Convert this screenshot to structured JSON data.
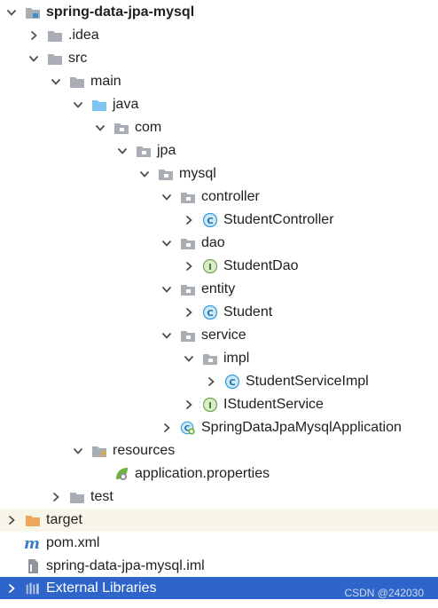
{
  "tree": [
    {
      "label": "spring-data-jpa-mysql",
      "icon": "project-folder-icon",
      "state": "expanded",
      "bold": true
    },
    {
      "label": ".idea",
      "icon": "folder-icon",
      "state": "collapsed"
    },
    {
      "label": "src",
      "icon": "folder-icon",
      "state": "expanded"
    },
    {
      "label": "main",
      "icon": "folder-icon",
      "state": "expanded"
    },
    {
      "label": "java",
      "icon": "source-folder-icon",
      "state": "expanded"
    },
    {
      "label": "com",
      "icon": "package-icon",
      "state": "expanded"
    },
    {
      "label": "jpa",
      "icon": "package-icon",
      "state": "expanded"
    },
    {
      "label": "mysql",
      "icon": "package-icon",
      "state": "expanded"
    },
    {
      "label": "controller",
      "icon": "package-icon",
      "state": "expanded"
    },
    {
      "label": "StudentController",
      "icon": "class-icon",
      "state": "collapsed"
    },
    {
      "label": "dao",
      "icon": "package-icon",
      "state": "expanded"
    },
    {
      "label": "StudentDao",
      "icon": "interface-icon",
      "state": "collapsed"
    },
    {
      "label": "entity",
      "icon": "package-icon",
      "state": "expanded"
    },
    {
      "label": "Student",
      "icon": "class-icon",
      "state": "collapsed"
    },
    {
      "label": "service",
      "icon": "package-icon",
      "state": "expanded"
    },
    {
      "label": "impl",
      "icon": "package-icon",
      "state": "expanded"
    },
    {
      "label": "StudentServiceImpl",
      "icon": "class-icon",
      "state": "collapsed"
    },
    {
      "label": "IStudentService",
      "icon": "interface-icon",
      "state": "collapsed"
    },
    {
      "label": "SpringDataJpaMysqlApplication",
      "icon": "spring-boot-app-icon",
      "state": "collapsed"
    },
    {
      "label": "resources",
      "icon": "resources-folder-icon",
      "state": "expanded"
    },
    {
      "label": "application.properties",
      "icon": "spring-properties-icon",
      "state": "none"
    },
    {
      "label": "test",
      "icon": "folder-icon",
      "state": "collapsed"
    },
    {
      "label": "target",
      "icon": "excluded-folder-icon",
      "state": "collapsed",
      "highlight": "yellow"
    },
    {
      "label": "pom.xml",
      "icon": "maven-icon",
      "state": "none"
    },
    {
      "label": "spring-data-jpa-mysql.iml",
      "icon": "iml-file-icon",
      "state": "none"
    },
    {
      "label": "External Libraries",
      "icon": "libraries-icon",
      "state": "collapsed",
      "highlight": "selected"
    }
  ],
  "watermark": "CSDN @242030",
  "colors": {
    "folder": "#a9aeb5",
    "source_folder": "#7cc7ef",
    "excluded_folder": "#f0a65a",
    "class_icon": "#2d9ad6",
    "interface_icon": "#6da54d",
    "selection": "#2f65ca",
    "highlight_row": "#f8f6e9"
  }
}
